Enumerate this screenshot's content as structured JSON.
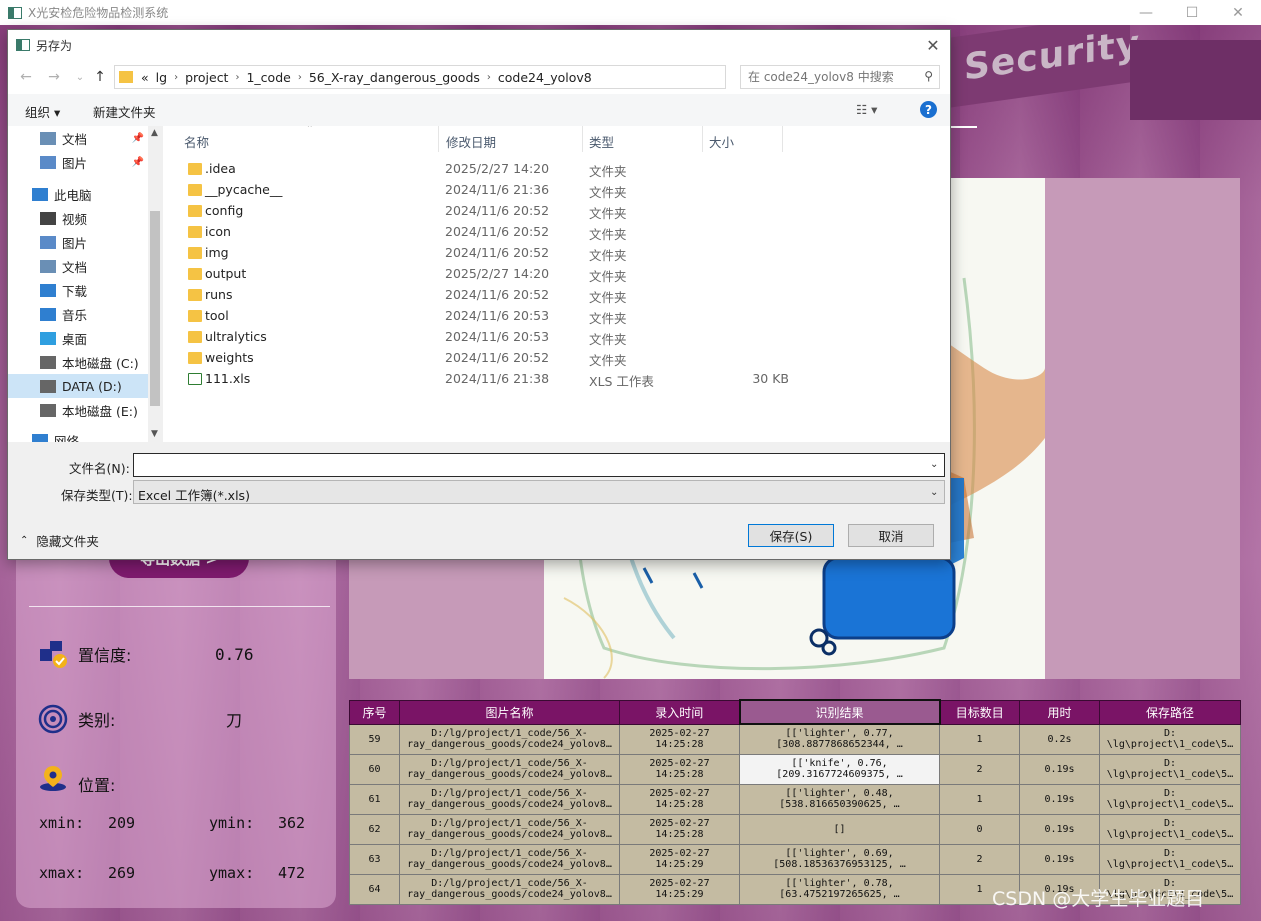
{
  "app": {
    "title": "X光安检危险物品检测系统",
    "sign_text": "Security",
    "export_label": "导出数据 >",
    "confidence_label": "置信度:",
    "confidence_value": "0.76",
    "class_label": "类别:",
    "class_value": "刀",
    "position_label": "位置:",
    "xmin_label": "xmin:",
    "xmin_value": "209",
    "ymin_label": "ymin:",
    "ymin_value": "362",
    "xmax_label": "xmax:",
    "xmax_value": "269",
    "ymax_label": "ymax:",
    "ymax_value": "472"
  },
  "table": {
    "headers": [
      "序号",
      "图片名称",
      "录入时间",
      "识别结果",
      "目标数目",
      "用时",
      "保存路径"
    ],
    "rows": [
      {
        "id": "59",
        "name1": "D:/lg/project/1_code/56_X-",
        "name2": "ray_dangerous_goods/code24_yolov8…",
        "t1": "2025-02-27",
        "t2": "14:25:28",
        "r1": "[['lighter', 0.77,",
        "r2": "[308.8877868652344, …",
        "count": "1",
        "time": "0.2s",
        "p1": "D:",
        "p2": "\\lg\\project\\1_code\\5…"
      },
      {
        "id": "60",
        "name1": "D:/lg/project/1_code/56_X-",
        "name2": "ray_dangerous_goods/code24_yolov8…",
        "t1": "2025-02-27",
        "t2": "14:25:28",
        "r1": "[['knife', 0.76,",
        "r2": "[209.3167724609375, …",
        "count": "2",
        "time": "0.19s",
        "p1": "D:",
        "p2": "\\lg\\project\\1_code\\5…"
      },
      {
        "id": "61",
        "name1": "D:/lg/project/1_code/56_X-",
        "name2": "ray_dangerous_goods/code24_yolov8…",
        "t1": "2025-02-27",
        "t2": "14:25:28",
        "r1": "[['lighter', 0.48,",
        "r2": "[538.816650390625, …",
        "count": "1",
        "time": "0.19s",
        "p1": "D:",
        "p2": "\\lg\\project\\1_code\\5…"
      },
      {
        "id": "62",
        "name1": "D:/lg/project/1_code/56_X-",
        "name2": "ray_dangerous_goods/code24_yolov8…",
        "t1": "2025-02-27",
        "t2": "14:25:28",
        "r1": "[]",
        "r2": "",
        "count": "0",
        "time": "0.19s",
        "p1": "D:",
        "p2": "\\lg\\project\\1_code\\5…"
      },
      {
        "id": "63",
        "name1": "D:/lg/project/1_code/56_X-",
        "name2": "ray_dangerous_goods/code24_yolov8…",
        "t1": "2025-02-27",
        "t2": "14:25:29",
        "r1": "[['lighter', 0.69,",
        "r2": "[508.18536376953125, …",
        "count": "2",
        "time": "0.19s",
        "p1": "D:",
        "p2": "\\lg\\project\\1_code\\5…"
      },
      {
        "id": "64",
        "name1": "D:/lg/project/1_code/56_X-",
        "name2": "ray_dangerous_goods/code24_yolov8…",
        "t1": "2025-02-27",
        "t2": "14:25:29",
        "r1": "[['lighter', 0.78,",
        "r2": "[63.4752197265625, …",
        "count": "1",
        "time": "0.19s",
        "p1": "D:",
        "p2": "\\lg\\project\\1_code\\5…"
      }
    ]
  },
  "watermark": "CSDN @大学生毕业题目",
  "dialog": {
    "title": "另存为",
    "breadcrumbs": [
      "«",
      "lg",
      "project",
      "1_code",
      "56_X-ray_dangerous_goods",
      "code24_yolov8"
    ],
    "search_placeholder": "在 code24_yolov8 中搜索",
    "organize_label": "组织 ▾",
    "new_folder_label": "新建文件夹",
    "nav_items": [
      {
        "label": "文档",
        "icon": "document-icon",
        "pinned": true
      },
      {
        "label": "图片",
        "icon": "pictures-icon",
        "pinned": true
      },
      {
        "label": "此电脑",
        "icon": "computer-icon",
        "pinned": false
      },
      {
        "label": "视频",
        "icon": "video-icon",
        "pinned": false
      },
      {
        "label": "图片",
        "icon": "pictures-icon",
        "pinned": false
      },
      {
        "label": "文档",
        "icon": "document-icon",
        "pinned": false
      },
      {
        "label": "下载",
        "icon": "download-icon",
        "pinned": false
      },
      {
        "label": "音乐",
        "icon": "music-icon",
        "pinned": false
      },
      {
        "label": "桌面",
        "icon": "desktop-icon",
        "pinned": false
      },
      {
        "label": "本地磁盘 (C:)",
        "icon": "drive-icon",
        "pinned": false
      },
      {
        "label": "DATA (D:)",
        "icon": "drive-icon",
        "pinned": false,
        "selected": true
      },
      {
        "label": "本地磁盘 (E:)",
        "icon": "drive-icon",
        "pinned": false
      },
      {
        "label": "网络",
        "icon": "network-icon",
        "pinned": false
      }
    ],
    "columns": {
      "name": "名称",
      "date": "修改日期",
      "type": "类型",
      "size": "大小"
    },
    "files": [
      {
        "name": ".idea",
        "date": "2025/2/27 14:20",
        "type": "文件夹",
        "size": ""
      },
      {
        "name": "__pycache__",
        "date": "2024/11/6 21:36",
        "type": "文件夹",
        "size": ""
      },
      {
        "name": "config",
        "date": "2024/11/6 20:52",
        "type": "文件夹",
        "size": ""
      },
      {
        "name": "icon",
        "date": "2024/11/6 20:52",
        "type": "文件夹",
        "size": ""
      },
      {
        "name": "img",
        "date": "2024/11/6 20:52",
        "type": "文件夹",
        "size": ""
      },
      {
        "name": "output",
        "date": "2025/2/27 14:20",
        "type": "文件夹",
        "size": ""
      },
      {
        "name": "runs",
        "date": "2024/11/6 20:52",
        "type": "文件夹",
        "size": ""
      },
      {
        "name": "tool",
        "date": "2024/11/6 20:53",
        "type": "文件夹",
        "size": ""
      },
      {
        "name": "ultralytics",
        "date": "2024/11/6 20:53",
        "type": "文件夹",
        "size": ""
      },
      {
        "name": "weights",
        "date": "2024/11/6 20:52",
        "type": "文件夹",
        "size": ""
      },
      {
        "name": "111.xls",
        "date": "2024/11/6 21:38",
        "type": "XLS 工作表",
        "size": "30 KB"
      }
    ],
    "filename_label": "文件名(N):",
    "filename_value": "",
    "filetype_label": "保存类型(T):",
    "filetype_value": "Excel 工作簿(*.xls)",
    "hide_folders_label": "隐藏文件夹",
    "save_label": "保存(S)",
    "cancel_label": "取消"
  },
  "colors": {
    "table_header": "#7a1466",
    "table_cell": "#c4bba2",
    "export_button": "#7e1a6e",
    "accent": "#0078d7"
  }
}
